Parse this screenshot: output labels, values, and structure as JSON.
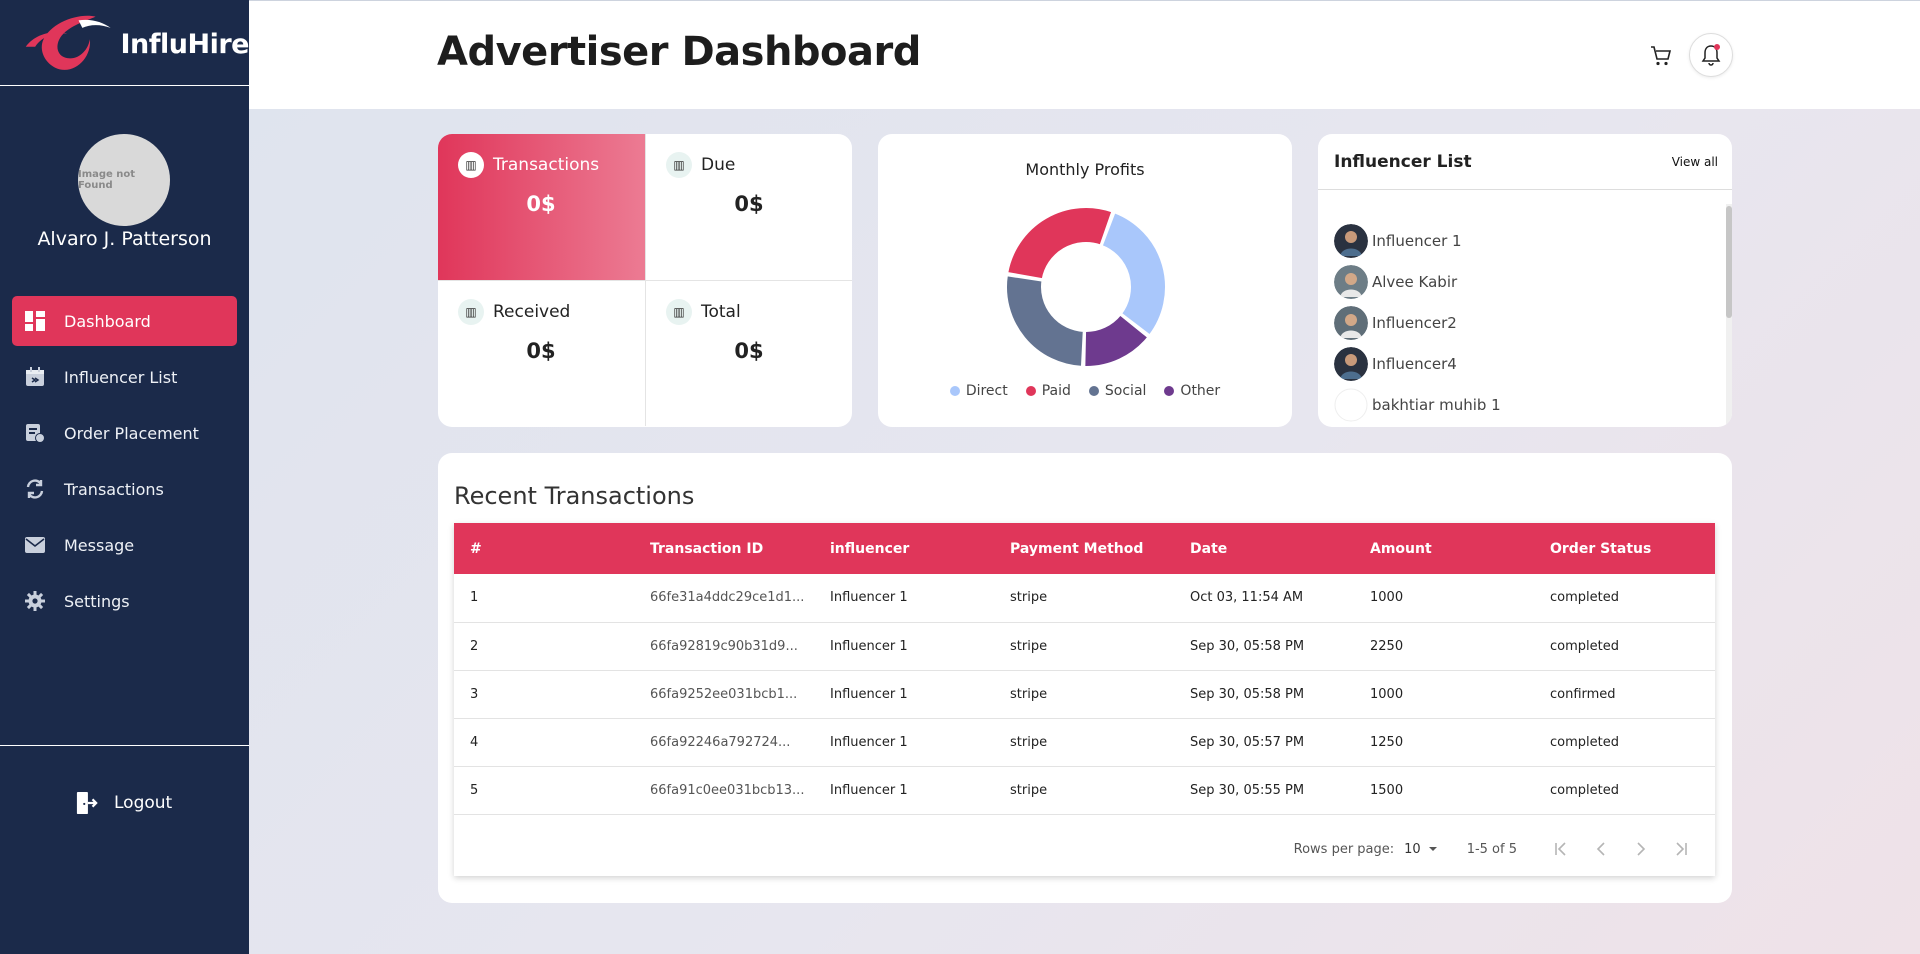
{
  "brand": {
    "name": "InfluHire"
  },
  "user": {
    "name": "Alvaro J. Patterson",
    "avatar_alt": "Image not Found"
  },
  "sidebar": {
    "items": [
      {
        "label": "Dashboard",
        "icon": "dashboard-icon",
        "active": true
      },
      {
        "label": "Influencer List",
        "icon": "calendar-icon"
      },
      {
        "label": "Order Placement",
        "icon": "order-icon"
      },
      {
        "label": "Transactions",
        "icon": "transfer-icon"
      },
      {
        "label": "Message",
        "icon": "mail-icon"
      },
      {
        "label": "Settings",
        "icon": "gear-icon"
      }
    ],
    "logout_label": "Logout"
  },
  "header": {
    "title": "Advertiser Dashboard"
  },
  "stats": [
    {
      "label": "Transactions",
      "value": "0$"
    },
    {
      "label": "Due",
      "value": "0$"
    },
    {
      "label": "Received",
      "value": "0$"
    },
    {
      "label": "Total",
      "value": "0$"
    }
  ],
  "profits": {
    "title": "Monthly Profits",
    "legend": [
      {
        "label": "Direct",
        "color": "#a9c7fb"
      },
      {
        "label": "Paid",
        "color": "#e0365a"
      },
      {
        "label": "Social",
        "color": "#637391"
      },
      {
        "label": "Other",
        "color": "#6e3a8e"
      }
    ]
  },
  "chart_data": {
    "type": "pie",
    "title": "Monthly Profits",
    "categories": [
      "Direct",
      "Other",
      "Social",
      "Paid"
    ],
    "values": [
      30,
      15,
      27,
      28
    ],
    "colors": [
      "#a9c7fb",
      "#6e3a8e",
      "#637391",
      "#e0365a"
    ]
  },
  "influencers": {
    "title": "Influencer List",
    "view_all": "View all",
    "items": [
      {
        "name": "Influencer 1"
      },
      {
        "name": "Alvee Kabir"
      },
      {
        "name": "Influencer2"
      },
      {
        "name": "Influencer4"
      },
      {
        "name": "bakhtiar muhib 1"
      }
    ]
  },
  "recent": {
    "title": "Recent Transactions",
    "columns": [
      "#",
      "Transaction ID",
      "influencer",
      "Payment Method",
      "Date",
      "Amount",
      "Order Status"
    ],
    "rows": [
      [
        "1",
        "66fe31a4ddc29ce1d1...",
        "Influencer 1",
        "stripe",
        "Oct 03, 11:54 AM",
        "1000",
        "completed"
      ],
      [
        "2",
        "66fa92819c90b31d9...",
        "Influencer 1",
        "stripe",
        "Sep 30, 05:58 PM",
        "2250",
        "completed"
      ],
      [
        "3",
        "66fa9252ee031bcb1...",
        "Influencer 1",
        "stripe",
        "Sep 30, 05:58 PM",
        "1000",
        "confirmed"
      ],
      [
        "4",
        "66fa92246a792724...",
        "Influencer 1",
        "stripe",
        "Sep 30, 05:57 PM",
        "1250",
        "completed"
      ],
      [
        "5",
        "66fa91c0ee031bcb13...",
        "Influencer 1",
        "stripe",
        "Sep 30, 05:55 PM",
        "1500",
        "completed"
      ]
    ],
    "pagination": {
      "rows_per_page_label": "Rows per page:",
      "rows_per_page": "10",
      "range": "1-5 of 5"
    }
  }
}
